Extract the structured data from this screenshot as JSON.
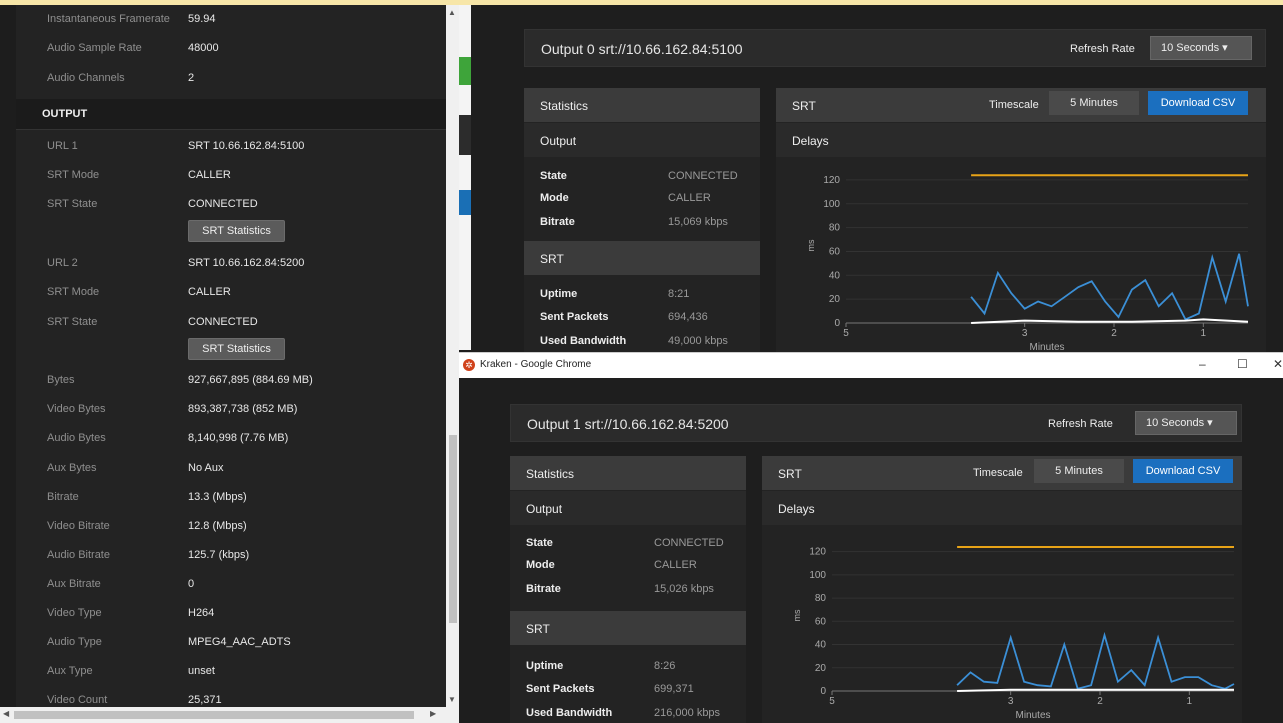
{
  "left_panel": {
    "top_rows": [
      {
        "label": "Instantaneous Framerate",
        "value": "59.94"
      },
      {
        "label": "Audio Sample Rate",
        "value": "48000"
      },
      {
        "label": "Audio Channels",
        "value": "2"
      }
    ],
    "section_title": "OUTPUT",
    "url1": [
      {
        "label": "URL 1",
        "value": "SRT 10.66.162.84:5100"
      },
      {
        "label": "SRT Mode",
        "value": "CALLER"
      },
      {
        "label": "SRT State",
        "value": "CONNECTED"
      }
    ],
    "url2": [
      {
        "label": "URL 2",
        "value": "SRT 10.66.162.84:5200"
      },
      {
        "label": "SRT Mode",
        "value": "CALLER"
      },
      {
        "label": "SRT State",
        "value": "CONNECTED"
      }
    ],
    "srt_stats_button": "SRT Statistics",
    "stats": [
      {
        "label": "Bytes",
        "value": "927,667,895 (884.69 MB)"
      },
      {
        "label": "Video Bytes",
        "value": "893,387,738 (852 MB)"
      },
      {
        "label": "Audio Bytes",
        "value": "8,140,998 (7.76 MB)"
      },
      {
        "label": "Aux Bytes",
        "value": "No Aux"
      },
      {
        "label": "Bitrate",
        "value": "13.3 (Mbps)"
      },
      {
        "label": "Video Bitrate",
        "value": "12.8 (Mbps)"
      },
      {
        "label": "Audio Bitrate",
        "value": "125.7 (kbps)"
      },
      {
        "label": "Aux Bitrate",
        "value": "0"
      },
      {
        "label": "Video Type",
        "value": "H264"
      },
      {
        "label": "Audio Type",
        "value": "MPEG4_AAC_ADTS"
      },
      {
        "label": "Aux Type",
        "value": "unset"
      },
      {
        "label": "Video Count",
        "value": "25,371"
      }
    ]
  },
  "chrome_title": "Kraken - Google Chrome",
  "window_controls": {
    "minimize": "–",
    "maximize": "☐",
    "close": "✕"
  },
  "outputs": [
    {
      "title": "Output 0 srt://10.66.162.84:5100",
      "refresh_label": "Refresh Rate",
      "refresh_value": "10 Seconds",
      "statistics_title": "Statistics",
      "output_title": "Output",
      "output_rows": [
        {
          "label": "State",
          "value": "CONNECTED"
        },
        {
          "label": "Mode",
          "value": "CALLER"
        },
        {
          "label": "Bitrate",
          "value": "15,069 kbps"
        }
      ],
      "srt_title": "SRT",
      "srt_rows": [
        {
          "label": "Uptime",
          "value": "8:21"
        },
        {
          "label": "Sent Packets",
          "value": "694,436"
        },
        {
          "label": "Used Bandwidth",
          "value": "49,000 kbps"
        }
      ],
      "chart_panel_title": "SRT",
      "timescale_label": "Timescale",
      "timescale_value": "5 Minutes",
      "download_label": "Download CSV",
      "delays_title": "Delays"
    },
    {
      "title": "Output 1 srt://10.66.162.84:5200",
      "refresh_label": "Refresh Rate",
      "refresh_value": "10 Seconds",
      "statistics_title": "Statistics",
      "output_title": "Output",
      "output_rows": [
        {
          "label": "State",
          "value": "CONNECTED"
        },
        {
          "label": "Mode",
          "value": "CALLER"
        },
        {
          "label": "Bitrate",
          "value": "15,026 kbps"
        }
      ],
      "srt_title": "SRT",
      "srt_rows": [
        {
          "label": "Uptime",
          "value": "8:26"
        },
        {
          "label": "Sent Packets",
          "value": "699,371"
        },
        {
          "label": "Used Bandwidth",
          "value": "216,000 kbps"
        }
      ],
      "chart_panel_title": "SRT",
      "timescale_label": "Timescale",
      "timescale_value": "5 Minutes",
      "download_label": "Download CSV",
      "delays_title": "Delays"
    }
  ],
  "chart_data": [
    {
      "type": "line",
      "xlabel": "Minutes",
      "ylabel": "ms",
      "ylim": [
        0,
        130
      ],
      "yticks": [
        0,
        20,
        40,
        60,
        80,
        100,
        120
      ],
      "xlim": [
        5,
        0.5
      ],
      "xticks": [
        5,
        3,
        2,
        1
      ],
      "series": [
        {
          "color": "#e8a317",
          "x": [
            3.6,
            0.5
          ],
          "values": [
            124,
            124
          ]
        },
        {
          "color": "#3b8fd6",
          "x": [
            3.6,
            3.45,
            3.3,
            3.15,
            3.0,
            2.85,
            2.7,
            2.55,
            2.4,
            2.25,
            2.1,
            1.95,
            1.8,
            1.65,
            1.5,
            1.35,
            1.2,
            1.05,
            0.9,
            0.75,
            0.6,
            0.5
          ],
          "values": [
            22,
            8,
            42,
            25,
            12,
            18,
            14,
            22,
            30,
            35,
            18,
            5,
            28,
            36,
            14,
            25,
            3,
            8,
            55,
            18,
            58,
            14
          ]
        },
        {
          "color": "#ffffff",
          "x": [
            3.6,
            3.0,
            2.4,
            1.8,
            1.2,
            1.0,
            0.5
          ],
          "values": [
            0,
            2,
            1,
            1,
            2,
            3,
            1
          ]
        }
      ]
    },
    {
      "type": "line",
      "xlabel": "Minutes",
      "ylabel": "ms",
      "ylim": [
        0,
        130
      ],
      "yticks": [
        0,
        20,
        40,
        60,
        80,
        100,
        120
      ],
      "xlim": [
        5,
        0.5
      ],
      "xticks": [
        5,
        3,
        2,
        1
      ],
      "series": [
        {
          "color": "#e8a317",
          "x": [
            3.6,
            0.5
          ],
          "values": [
            124,
            124
          ]
        },
        {
          "color": "#3b8fd6",
          "x": [
            3.6,
            3.45,
            3.3,
            3.15,
            3.0,
            2.85,
            2.7,
            2.55,
            2.4,
            2.25,
            2.1,
            1.95,
            1.8,
            1.65,
            1.5,
            1.35,
            1.2,
            1.05,
            0.9,
            0.75,
            0.6,
            0.5
          ],
          "values": [
            5,
            16,
            8,
            7,
            46,
            8,
            5,
            4,
            40,
            2,
            5,
            48,
            8,
            18,
            5,
            46,
            8,
            12,
            12,
            5,
            2,
            6
          ]
        },
        {
          "color": "#ffffff",
          "x": [
            3.6,
            3.0,
            2.4,
            1.8,
            1.2,
            0.5
          ],
          "values": [
            0,
            1,
            1,
            1,
            1,
            1
          ]
        }
      ]
    }
  ]
}
